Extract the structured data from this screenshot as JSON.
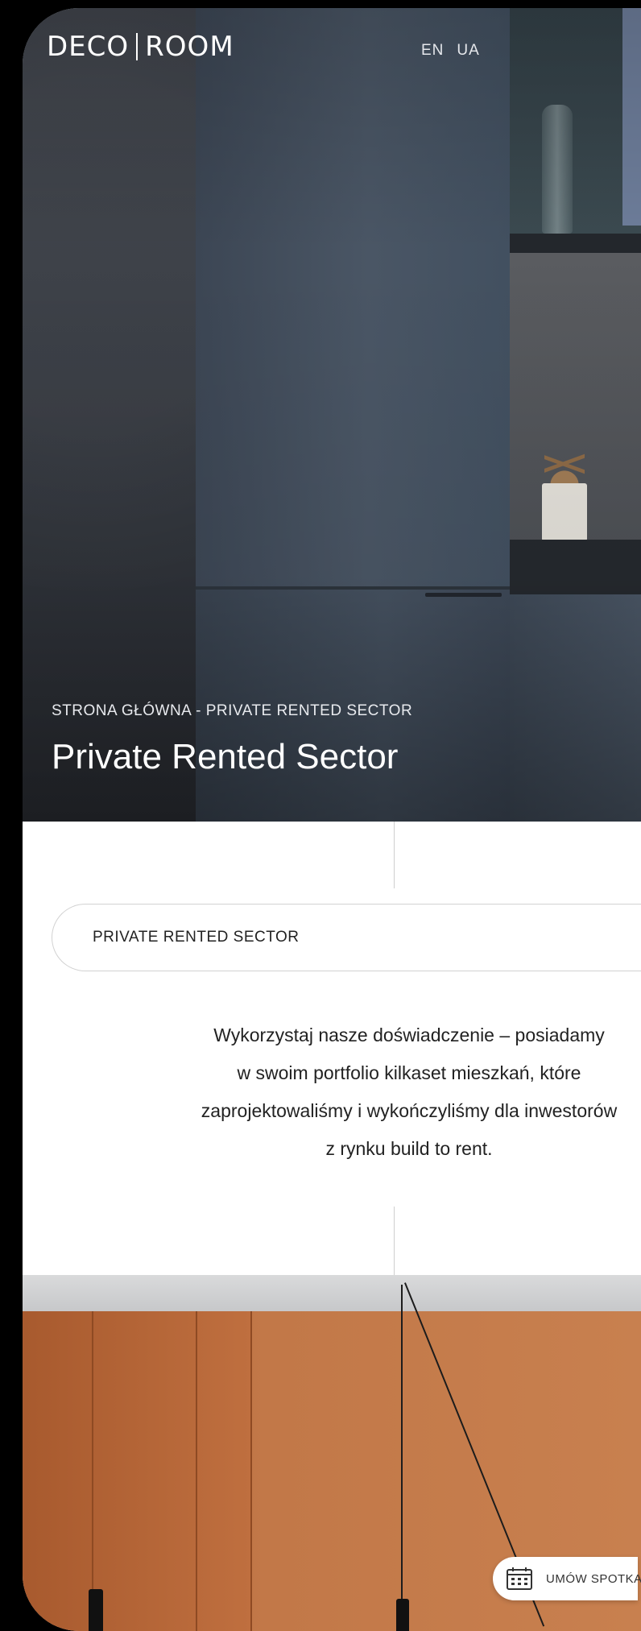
{
  "header": {
    "logo_left": "DECO",
    "logo_right": "ROOM",
    "languages": [
      "EN",
      "UA"
    ]
  },
  "hero": {
    "breadcrumb": "STRONA GŁÓWNA - PRIVATE RENTED SECTOR",
    "title": "Private Rented Sector"
  },
  "section": {
    "pill_label": "PRIVATE RENTED SECTOR",
    "intro_lines": [
      "Wykorzystaj nasze doświadczenie – posiadamy",
      "w swoim portfolio kilkaset mieszkań, które",
      "zaprojektowaliśmy i wykończyliśmy dla inwestorów",
      "z rynku build to rent."
    ]
  },
  "cta": {
    "label": "UMÓW SPOTKANIE",
    "icon": "calendar-icon"
  },
  "colors": {
    "hero_bg": "#3d4450",
    "room_orange": "#c27848",
    "text_dark": "#222222"
  }
}
